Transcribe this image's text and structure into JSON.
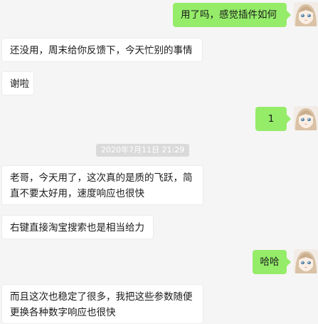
{
  "messages": [
    {
      "side": "right",
      "text": "用了吗，感觉插件如何"
    },
    {
      "side": "left",
      "text": "还没用，周末给你反馈下，今天忙别的事情"
    },
    {
      "side": "left",
      "text": "谢啦"
    },
    {
      "side": "right",
      "text": "1"
    },
    {
      "side": "left",
      "text": "老哥，今天用了，这次真的是质的飞跃，简直不要太好用，速度响应也很快"
    },
    {
      "side": "left",
      "text": "右键直接淘宝搜索也是相当给力"
    },
    {
      "side": "right",
      "text": "哈哈"
    },
    {
      "side": "left",
      "text": "而且这次也稳定了很多，我把这些参数随便更换各种数字响应也很快"
    }
  ],
  "timestamp": "2020年7月11日 21:29",
  "colors": {
    "background": "#f5f5f5",
    "bubble_sent": "#95ec69",
    "bubble_received": "#ffffff",
    "timestamp_bg": "#dadada"
  },
  "avatar_icon": "anime-girl-avatar-icon"
}
